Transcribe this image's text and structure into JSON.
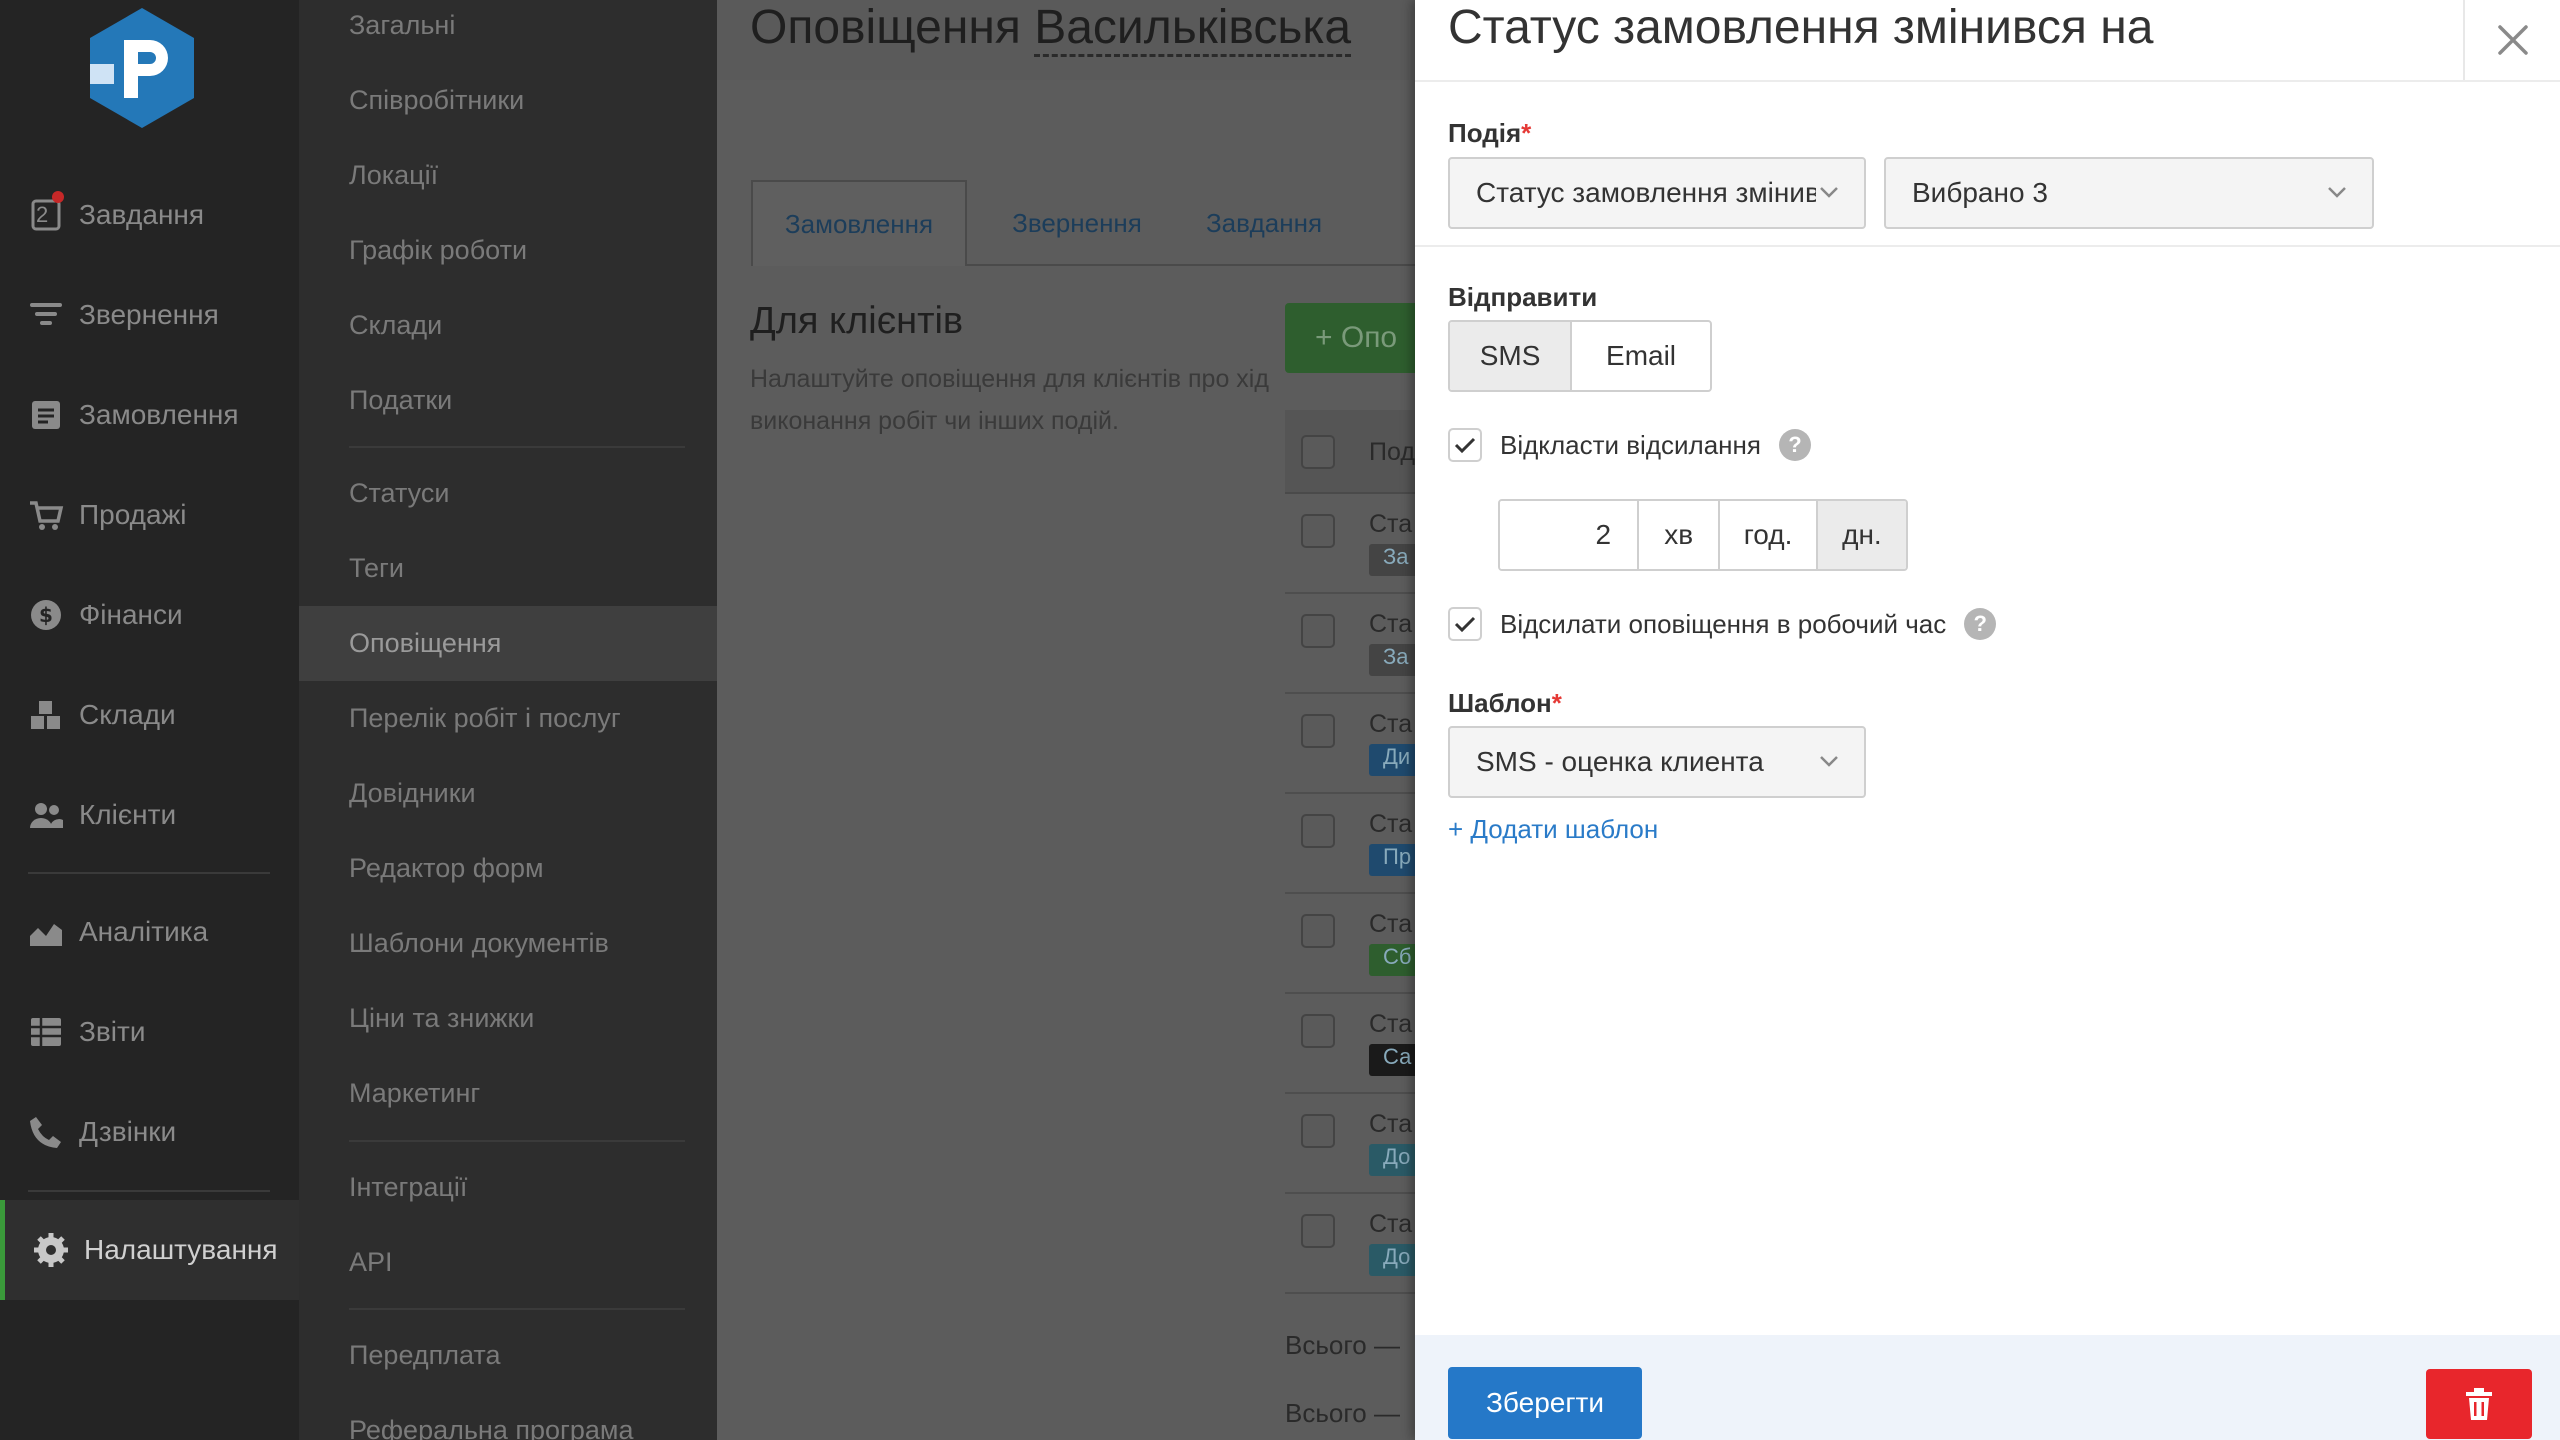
{
  "nav": {
    "items": [
      {
        "label": "Завдання",
        "icon": "tasks-icon",
        "badge": "2"
      },
      {
        "label": "Звернення",
        "icon": "filter-icon"
      },
      {
        "label": "Замовлення",
        "icon": "orders-icon"
      },
      {
        "label": "Продажі",
        "icon": "cart-icon"
      },
      {
        "label": "Фінанси",
        "icon": "dollar-icon"
      },
      {
        "label": "Склади",
        "icon": "boxes-icon"
      },
      {
        "label": "Клієнти",
        "icon": "users-icon"
      },
      {
        "label": "Аналітика",
        "icon": "chart-icon"
      },
      {
        "label": "Звіти",
        "icon": "table-icon"
      },
      {
        "label": "Дзвінки",
        "icon": "phone-icon"
      },
      {
        "label": "Налаштування",
        "icon": "gear-icon",
        "active": true
      }
    ]
  },
  "submenu": {
    "items": [
      "Загальні",
      "Співробітники",
      "Локації",
      "Графік роботи",
      "Склади",
      "Податки",
      "Статуси",
      "Теги",
      "Оповіщення",
      "Перелік робіт і послуг",
      "Довідники",
      "Редактор форм",
      "Шаблони документів",
      "Ціни та знижки",
      "Маркетинг",
      "Інтеграції",
      "API",
      "Передплата",
      "Реферальна програма"
    ],
    "active": "Оповіщення"
  },
  "main": {
    "title_prefix": "Оповіщення",
    "title_location": "Васильківська",
    "tabs": [
      "Замовлення",
      "Звернення",
      "Завдання"
    ],
    "active_tab": "Замовлення",
    "section_title": "Для клієнтів",
    "section_desc": "Налаштуйте оповіщення для клієнтів про хід виконання робіт чи інших подій.",
    "add_button": "+ Опо",
    "table_header": "Под",
    "rows": [
      {
        "text": "Ста",
        "badge": "За",
        "badge_color": "#444"
      },
      {
        "text": "Ста",
        "badge": "За",
        "badge_color": "#444"
      },
      {
        "text": "Ста",
        "badge": "Ди",
        "badge_color": "#1f4a6e"
      },
      {
        "text": "Ста",
        "badge": "Пр",
        "badge_color": "#1f4a6e"
      },
      {
        "text": "Ста",
        "badge": "Сб",
        "badge_color": "#2e5e2e"
      },
      {
        "text": "Ста",
        "badge": "Са",
        "badge_color": "#1a1a1a"
      },
      {
        "text": "Ста",
        "badge": "До",
        "badge_color": "#2a5a66"
      },
      {
        "text": "Ста",
        "badge": "До",
        "badge_color": "#2a5a66"
      }
    ],
    "total_1": "Всього —",
    "total_2": "Всього —"
  },
  "panel": {
    "title": "Статус замовлення змінився на",
    "event_label": "Подія",
    "event_value": "Статус замовлення змінився на",
    "selected_value": "Вибрано 3",
    "send_label": "Відправити",
    "send_options": [
      "SMS",
      "Email"
    ],
    "send_selected": "SMS",
    "delay_label": "Відкласти відсилання",
    "delay_value": "2",
    "delay_units": [
      "хв",
      "год.",
      "дн."
    ],
    "delay_unit_selected": "дн.",
    "worktime_label": "Відсилати оповіщення в робочий час",
    "template_label": "Шаблон",
    "template_value": "SMS - оценка клиента",
    "add_template": "+ Додати шаблон",
    "save": "Зберегти",
    "help_glyph": "?"
  }
}
